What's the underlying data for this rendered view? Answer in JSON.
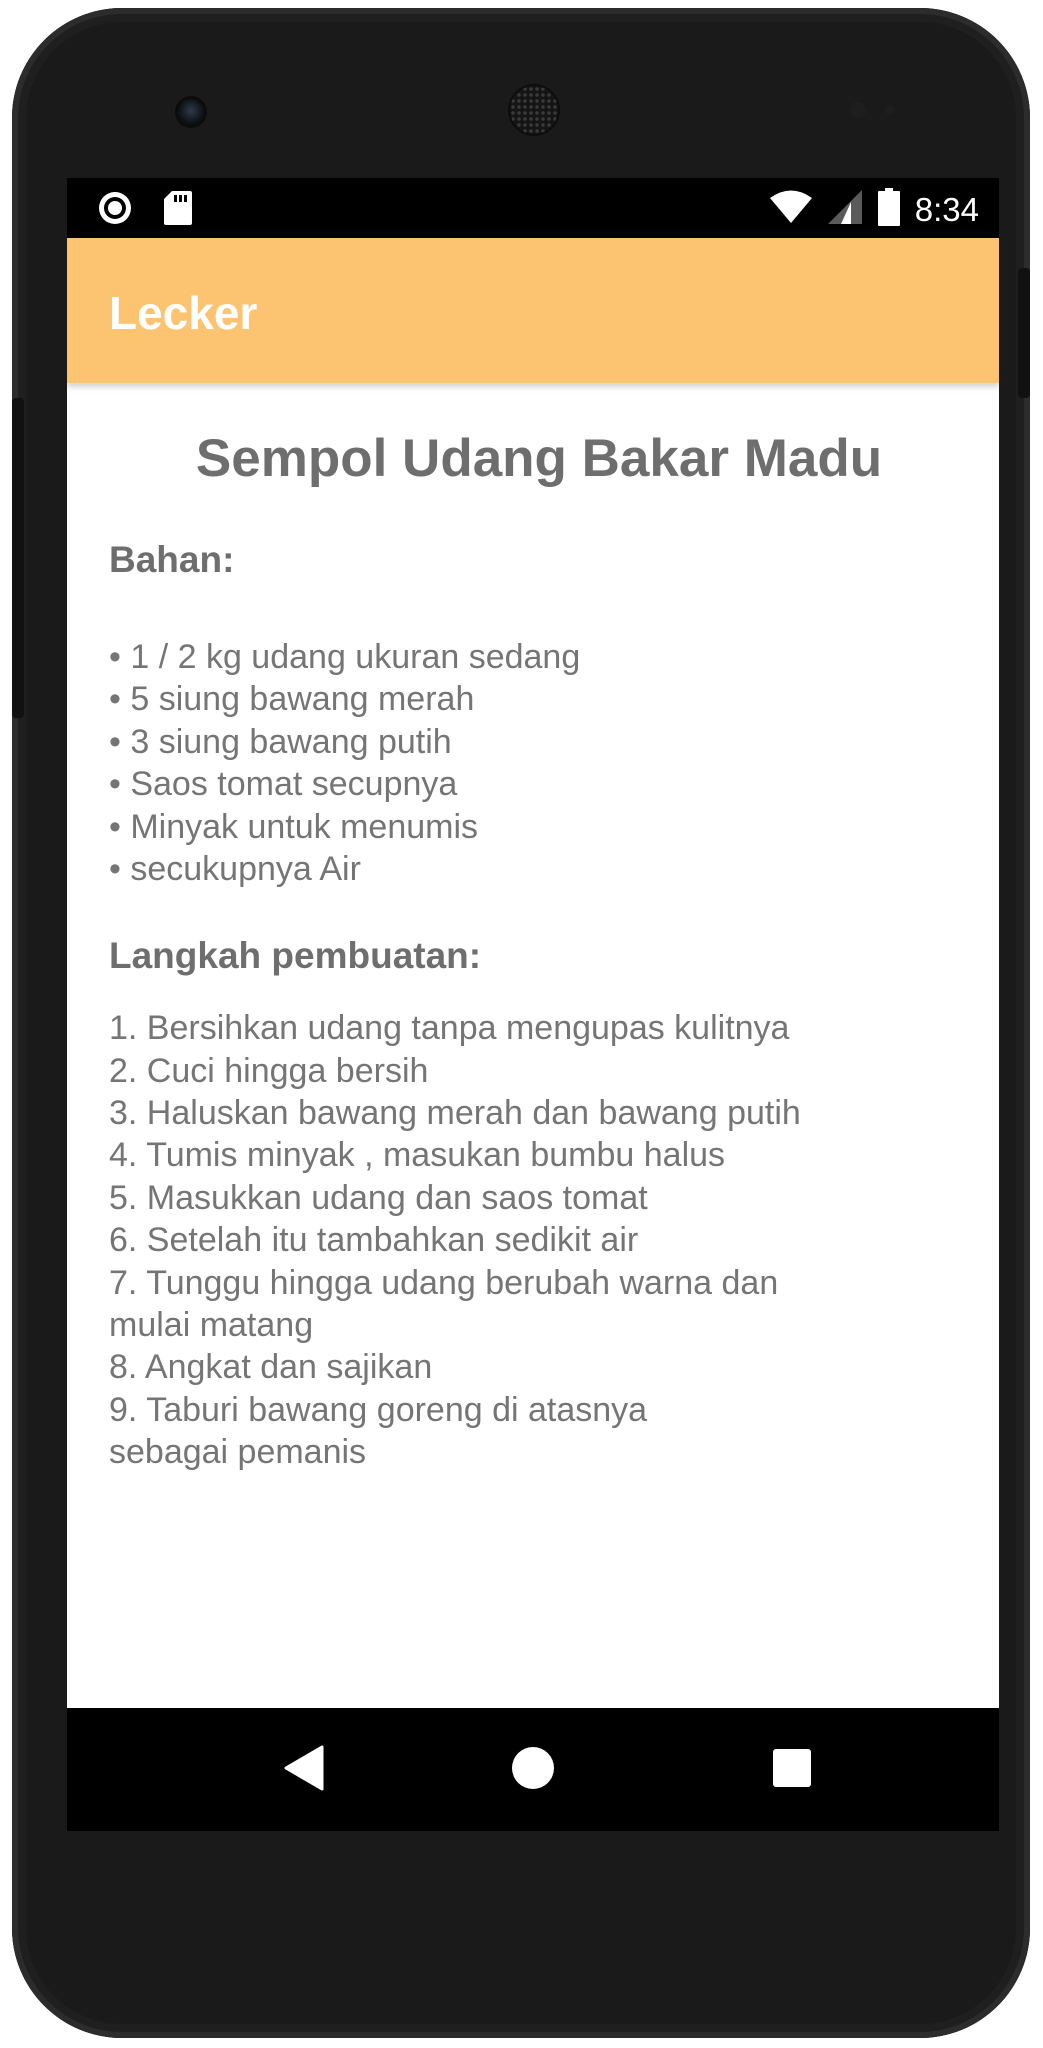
{
  "status_bar": {
    "time": "8:34",
    "left_icons": [
      "record-icon",
      "sd-card-icon"
    ],
    "right_icons": [
      "wifi-icon",
      "cellular-signal-icon",
      "battery-icon"
    ]
  },
  "app_bar": {
    "title": "Lecker",
    "color": "#fcc471"
  },
  "recipe": {
    "title": "Sempol Udang Bakar Madu",
    "ingredients_heading": "Bahan:",
    "ingredients": [
      "• 1 / 2 kg udang ukuran sedang",
      "• 5 siung bawang merah",
      "• 3 siung bawang putih",
      "• Saos tomat secupnya",
      "• Minyak untuk menumis",
      "• secukupnya Air"
    ],
    "steps_heading": "Langkah pembuatan:",
    "steps": [
      "1. Bersihkan udang tanpa mengupas kulitnya",
      "2. Cuci hingga bersih",
      "3. Haluskan bawang merah dan bawang putih",
      "4. Tumis minyak , masukan bumbu halus",
      "5. Masukkan udang dan saos tomat",
      "6. Setelah itu tambahkan sedikit air",
      "7. Tunggu hingga udang berubah warna dan",
      "mulai matang",
      "8. Angkat dan sajikan",
      "9. Taburi bawang goreng di atasnya",
      "sebagai pemanis"
    ]
  },
  "nav_bar": {
    "buttons": [
      "back-icon",
      "home-icon",
      "recents-icon"
    ]
  }
}
